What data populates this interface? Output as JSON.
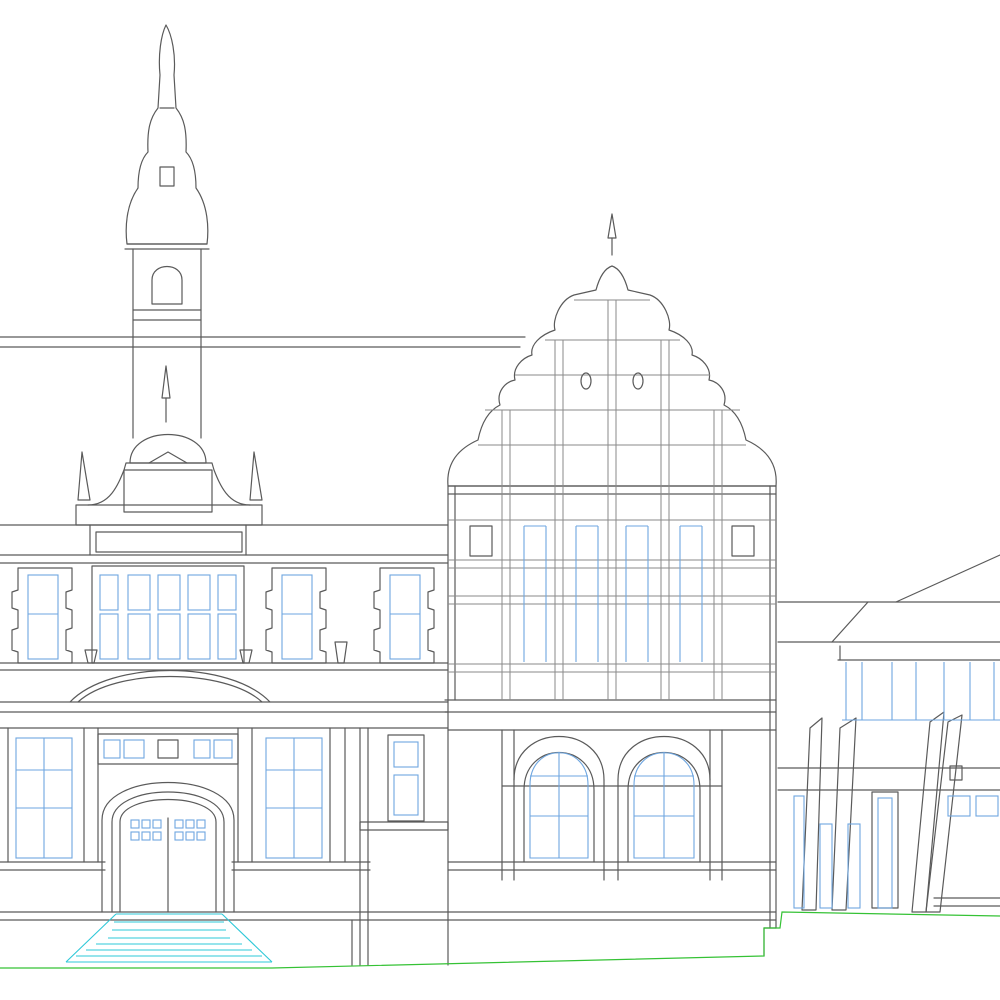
{
  "colors": {
    "background": "#ffffff",
    "structure_line": "#5a5a5a",
    "window_line": "#6ea6e0",
    "steps_line": "#2ec8d8",
    "ground_line": "#35c235"
  }
}
